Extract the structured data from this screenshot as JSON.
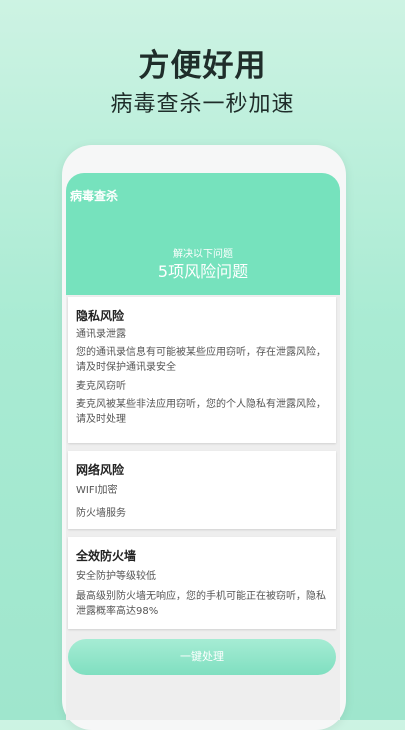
{
  "promo": {
    "headline": "方便好用",
    "subheadline": "病毒查杀一秒加速"
  },
  "screen": {
    "app_title": "病毒查杀",
    "issues_caption": "解决以下问题",
    "issues_count": "5项风险问题"
  },
  "cards": [
    {
      "title": "隐私风险",
      "items": [
        "通讯录泄露",
        "您的通讯录信息有可能被某些应用窃听，存在泄露风险，请及时保护通讯录安全",
        "麦克风窃听",
        "麦克风被某些非法应用窃听，您的个人隐私有泄露风险，请及时处理"
      ]
    },
    {
      "title": "网络风险",
      "items": [
        "WIFI加密",
        "防火墙服务"
      ]
    },
    {
      "title": "全效防火墙",
      "items": [
        "安全防护等级较低",
        "最高级别防火墙无响应，您的手机可能正在被窃听，隐私泄露概率高达98%"
      ]
    }
  ],
  "action_button": "一键处理",
  "colors": {
    "header_green": "#76e2bd",
    "button_green": "#7fdfc0",
    "background": "#a9ebd3"
  }
}
